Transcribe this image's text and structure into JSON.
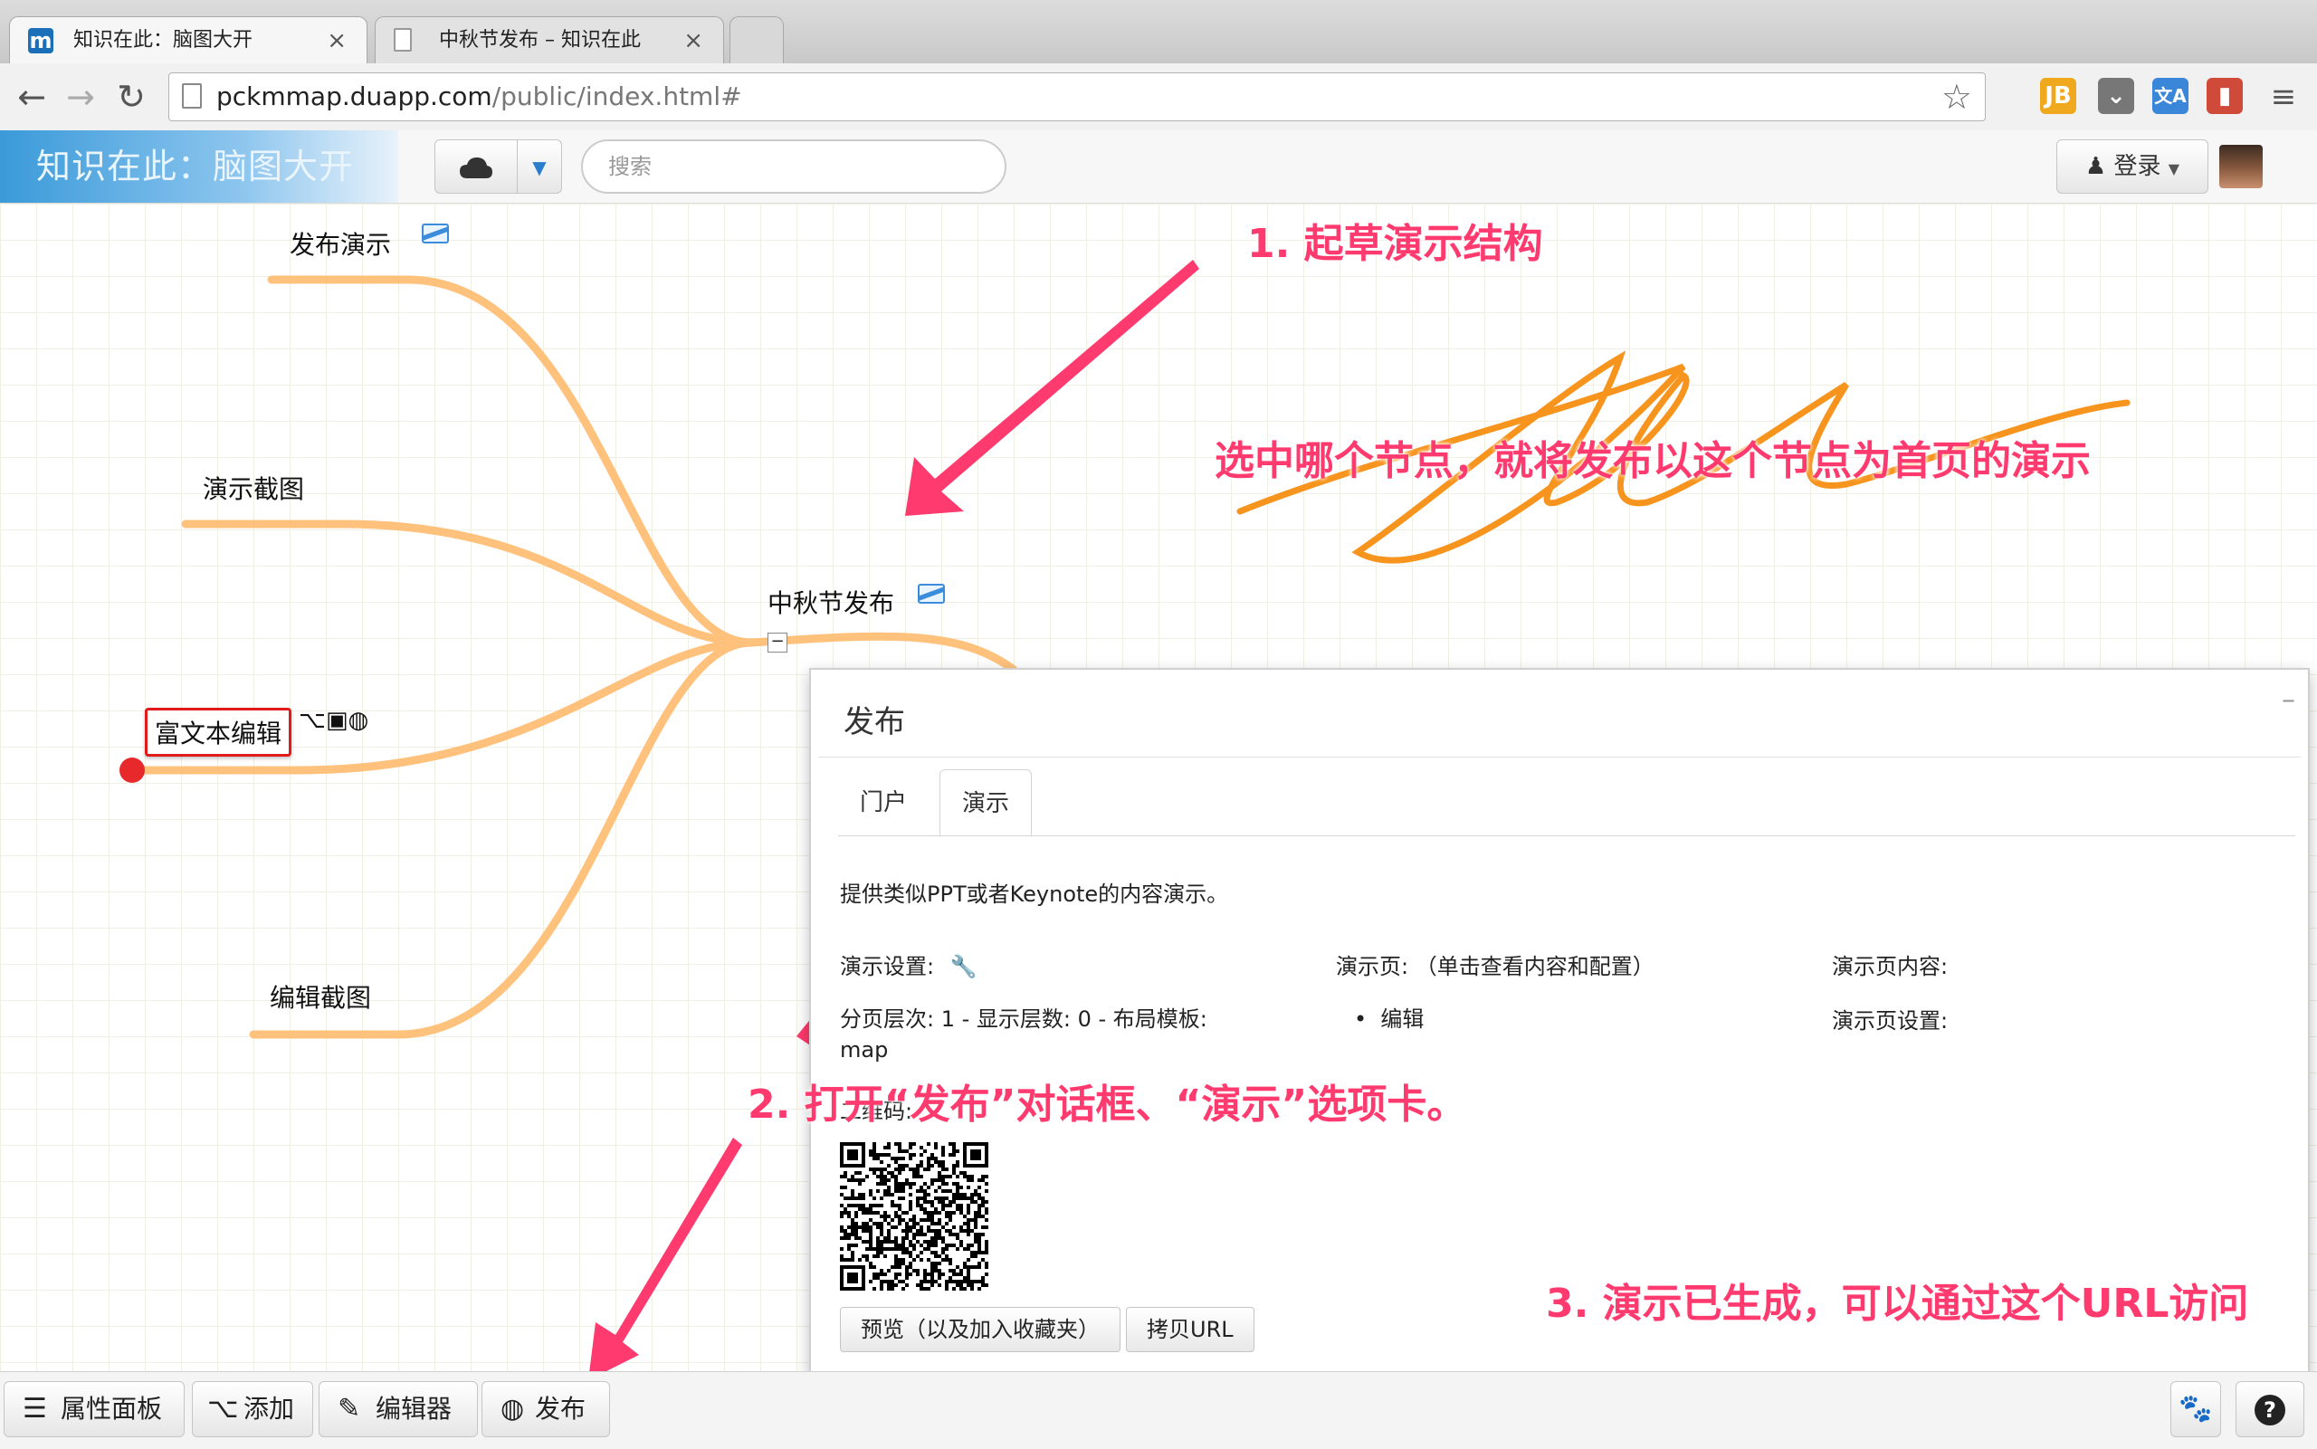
{
  "browser": {
    "tabs": [
      {
        "title": "知识在此：脑图大开",
        "favicon": "m"
      },
      {
        "title": "中秋节发布 – 知识在此"
      }
    ],
    "url_host": "pckmmap.duapp.com",
    "url_path": "/public/index.html#"
  },
  "header": {
    "brand": "知识在此：脑图大开",
    "search_placeholder": "搜索",
    "login_label": "登录"
  },
  "mindmap": {
    "root": "中秋节发布",
    "children": [
      "发布演示",
      "演示截图",
      "富文本编辑",
      "编辑截图"
    ],
    "collapse_symbol": "−"
  },
  "annotations": {
    "step1": "1. 起草演示结构",
    "step1_note": "选中哪个节点，就将发布以这个节点为首页的演示",
    "step2": "2. 打开“发布”对话框、“演示”选项卡。",
    "step3": "3. 演示已生成，可以通过这个URL访问"
  },
  "dialog": {
    "title": "发布",
    "minimize": "–",
    "tabs": [
      "门户",
      "演示"
    ],
    "active_tab": "演示",
    "description": "提供类似PPT或者Keynote的内容演示。",
    "settings_label": "演示设置:",
    "settings_value_line1": "分页层次: 1 - 显示层数: 0 - 布局模板:",
    "settings_value_line2": "map",
    "pages_label": "演示页: （单击查看内容和配置）",
    "pages_item": "编辑",
    "page_content_label": "演示页内容:",
    "page_settings_label": "演示页设置:",
    "qr_label": "二维码:",
    "preview_button": "预览（以及加入收藏夹）",
    "copy_button": "拷贝URL"
  },
  "bottombar": {
    "properties": "属性面板",
    "add": "添加",
    "editor": "编辑器",
    "publish": "发布",
    "help": "?"
  },
  "colors": {
    "accent_pink": "#ff3a6e",
    "branch_orange": "#ffb866",
    "scribble_orange": "#f7941d",
    "brand_blue": "#3a9ad9"
  }
}
